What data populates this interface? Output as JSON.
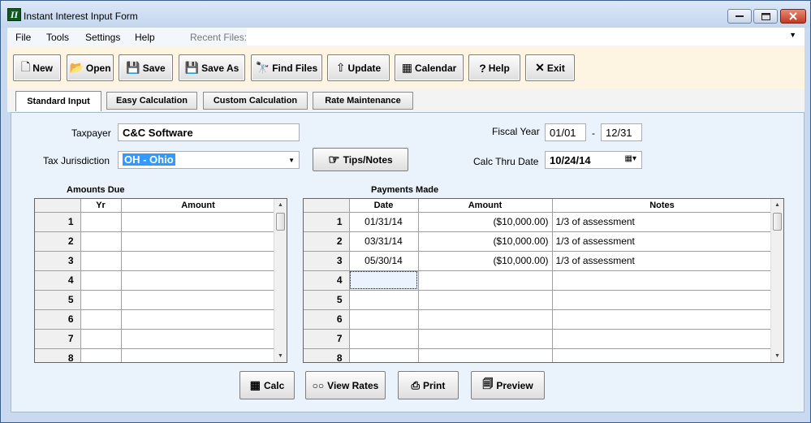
{
  "window": {
    "title": "Instant Interest Input Form",
    "icon_name": "app-icon",
    "app_icon_glyph": "II"
  },
  "menu": {
    "items": [
      "File",
      "Tools",
      "Settings",
      "Help"
    ],
    "recent_label": "Recent Files:",
    "recent_value": ""
  },
  "toolbar": {
    "buttons": [
      {
        "label": "New",
        "icon": "new-document-icon"
      },
      {
        "label": "Open",
        "icon": "open-folder-icon"
      },
      {
        "label": "Save",
        "icon": "save-icon"
      },
      {
        "label": "Save As",
        "icon": "save-as-icon"
      },
      {
        "label": "Find Files",
        "icon": "binoculars-icon"
      },
      {
        "label": "Update",
        "icon": "update-icon"
      },
      {
        "label": "Calendar",
        "icon": "calendar-icon"
      },
      {
        "label": "Help",
        "icon": "help-icon"
      },
      {
        "label": "Exit",
        "icon": "exit-icon"
      }
    ]
  },
  "tabs": [
    "Standard Input",
    "Easy Calculation",
    "Custom Calculation",
    "Rate Maintenance"
  ],
  "form": {
    "taxpayer_label": "Taxpayer",
    "taxpayer_value": "C&C Software",
    "jurisdiction_label": "Tax Jurisdiction",
    "jurisdiction_value": "OH  - Ohio",
    "tips_label": "Tips/Notes",
    "fiscal_year_label": "Fiscal Year",
    "fiscal_start": "01/01",
    "fiscal_sep": "-",
    "fiscal_end": "12/31",
    "calc_thru_label": "Calc Thru Date",
    "calc_thru_value": "10/24/14"
  },
  "amounts_due": {
    "title": "Amounts Due",
    "headers": [
      "Yr",
      "Amount"
    ],
    "rows": [
      "1",
      "2",
      "3",
      "4",
      "5",
      "6",
      "7",
      "8"
    ],
    "current_row": 2
  },
  "payments": {
    "title": "Payments Made",
    "headers": [
      "Date",
      "Amount",
      "Notes"
    ],
    "rows": [
      {
        "num": "1",
        "date": "01/31/14",
        "amount": "($10,000.00)",
        "notes": "1/3 of assessment"
      },
      {
        "num": "2",
        "date": "03/31/14",
        "amount": "($10,000.00)",
        "notes": "1/3 of assessment"
      },
      {
        "num": "3",
        "date": "05/30/14",
        "amount": "($10,000.00)",
        "notes": "1/3 of assessment"
      },
      {
        "num": "4",
        "date": "",
        "amount": "",
        "notes": ""
      },
      {
        "num": "5",
        "date": "",
        "amount": "",
        "notes": ""
      },
      {
        "num": "6",
        "date": "",
        "amount": "",
        "notes": ""
      },
      {
        "num": "7",
        "date": "",
        "amount": "",
        "notes": ""
      },
      {
        "num": "8",
        "date": "",
        "amount": "",
        "notes": ""
      }
    ],
    "current_row": 4
  },
  "bottom_buttons": [
    {
      "label": "Calc",
      "icon": "calculator-icon"
    },
    {
      "label": "View Rates",
      "icon": "glasses-icon"
    },
    {
      "label": "Print",
      "icon": "printer-icon"
    },
    {
      "label": "Preview",
      "icon": "preview-icon"
    }
  ]
}
